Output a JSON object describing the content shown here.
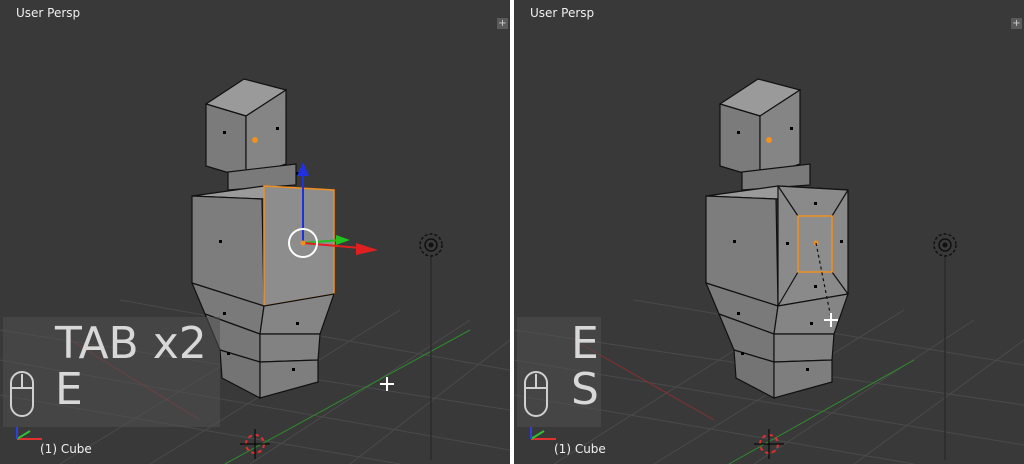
{
  "left_view": {
    "title": "User Persp",
    "key_overlay": "TAB x2\nE",
    "object_label": "(1) Cube"
  },
  "right_view": {
    "title": "User Persp",
    "key_overlay": "E\nS",
    "object_label": "(1) Cube"
  },
  "colors": {
    "viewport_bg": "#393939",
    "grid": "#4a4a4a",
    "mesh_face": "#8a8a8a",
    "mesh_edge": "#111111",
    "selection": "#f0901f",
    "axis_x": "#e02020",
    "axis_y": "#20c020",
    "axis_z": "#2030e0"
  },
  "icons": [
    "mouse-icon",
    "axis-widget-icon",
    "3d-cursor-icon",
    "lamp-icon",
    "transform-manipulator-icon",
    "viewport-options-icon"
  ]
}
